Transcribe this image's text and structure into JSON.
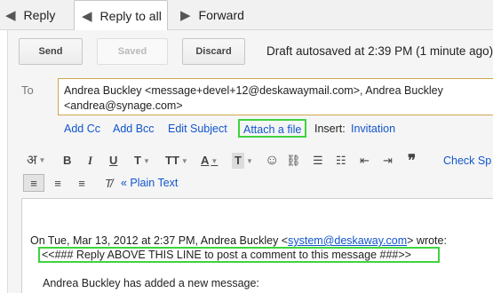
{
  "tabs": {
    "reply": {
      "label": "Reply",
      "icon": "reply-icon"
    },
    "reply_all": {
      "label": "Reply to all",
      "icon": "reply-all-icon"
    },
    "forward": {
      "label": "Forward",
      "icon": "forward-icon"
    }
  },
  "actions": {
    "send": "Send",
    "saved": "Saved",
    "discard": "Discard",
    "draft_status": "Draft autosaved at 2:39 PM (1 minute ago)"
  },
  "recipients": {
    "label": "To",
    "line1": "Andrea Buckley <message+devel+12@deskawaymail.com>, Andrea Buckley",
    "line2": "<andrea@synage.com>"
  },
  "compose_links": {
    "add_cc": "Add Cc",
    "add_bcc": "Add Bcc",
    "edit_subject": "Edit Subject",
    "attach_file": "Attach a file",
    "insert_label": "Insert:",
    "invitation": "Invitation"
  },
  "toolbar": {
    "input_tools_glyph": "अ",
    "bold": "B",
    "italic": "I",
    "underline": "U",
    "font": "T",
    "size": "TT",
    "text_color": "A",
    "highlight": "T",
    "emoji": "☺",
    "link": "⛓",
    "numbered_list": "☰",
    "bulleted_list": "☷",
    "indent_less": "⇤",
    "indent_more": "⇥",
    "quote": "❞",
    "check_spelling": "Check Sp",
    "plain_text": "« Plain Text",
    "icons": [
      "input-tools-icon",
      "bold-icon",
      "italic-icon",
      "underline-icon",
      "font-icon",
      "text-size-icon",
      "text-color-icon",
      "highlight-icon",
      "emoji-icon",
      "link-icon",
      "numbered-list-icon",
      "bulleted-list-icon",
      "indent-less-icon",
      "indent-more-icon",
      "quote-icon",
      "align-left-icon",
      "align-center-icon",
      "align-right-icon",
      "remove-formatting-icon"
    ]
  },
  "message": {
    "quote_intro": "On Tue, Mar 13, 2012 at 2:37 PM, Andrea Buckley <",
    "quote_email": "system@deskaway.com",
    "quote_end": "> wrote:",
    "reply_marker": "<<### Reply ABOVE THIS LINE to post a comment to this message ###>>",
    "body_line": "Andrea Buckley has added a new message:"
  },
  "colors": {
    "link": "#1155cc",
    "highlight_box": "#3ed33e",
    "recipient_border": "#d0a750"
  }
}
